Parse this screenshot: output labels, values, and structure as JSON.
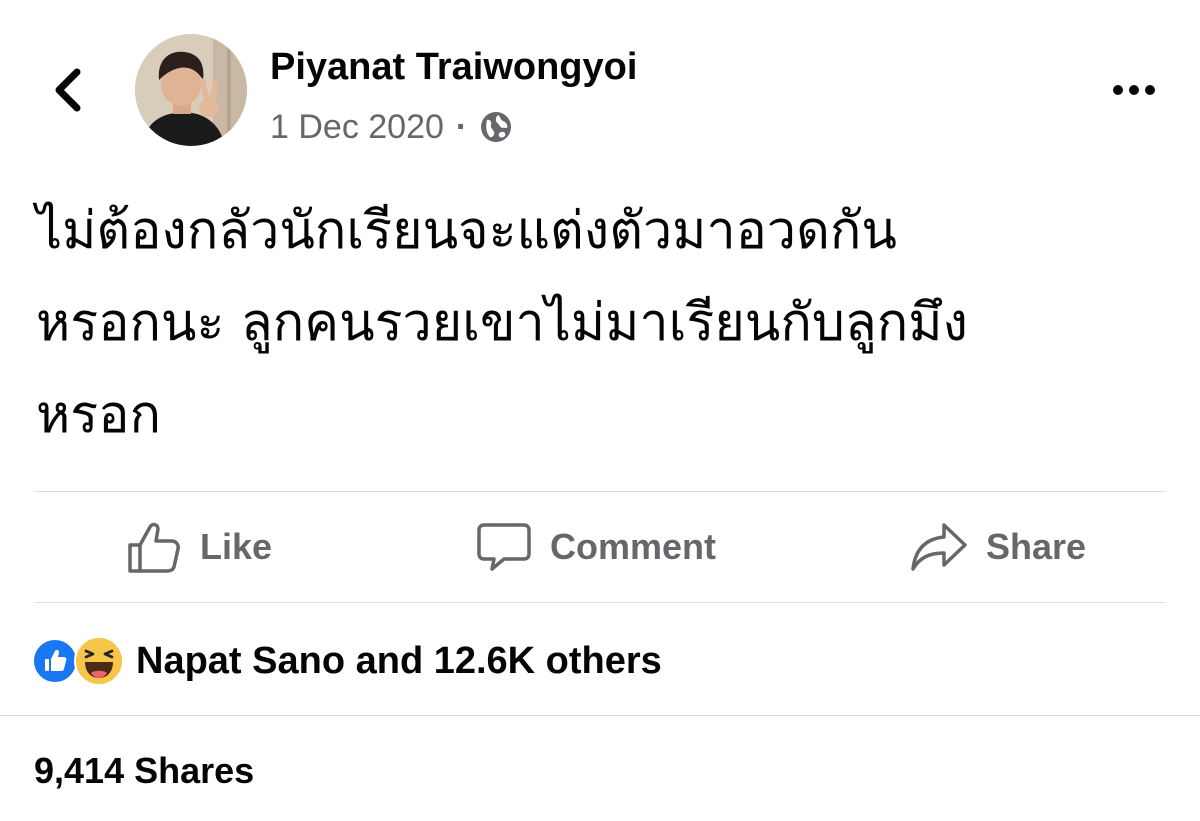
{
  "header": {
    "back_icon": "chevron-left-icon",
    "author_name": "Piyanat Traiwongyoi",
    "date": "1 Dec 2020",
    "separator": "·",
    "privacy_icon": "globe-icon",
    "more_icon": "more-horizontal-icon"
  },
  "post": {
    "text_lines": [
      "ไม่ต้องกลัวนักเรียนจะแต่งตัวมาอวดกัน",
      "หรอกนะ ลูกคนรวยเขาไม่มาเรียนกับลูกมึง",
      "หรอก"
    ]
  },
  "actions": {
    "like_label": "Like",
    "comment_label": "Comment",
    "share_label": "Share"
  },
  "reactions": {
    "icons": [
      "like-reaction-icon",
      "haha-reaction-icon"
    ],
    "summary": "Napat Sano and 12.6K others"
  },
  "shares": {
    "label": "9,414 Shares"
  },
  "colors": {
    "text_primary": "#050505",
    "text_secondary": "#65676b",
    "divider": "#dadde1",
    "like_blue": "#1877f2",
    "haha_yellow": "#f7c547"
  }
}
